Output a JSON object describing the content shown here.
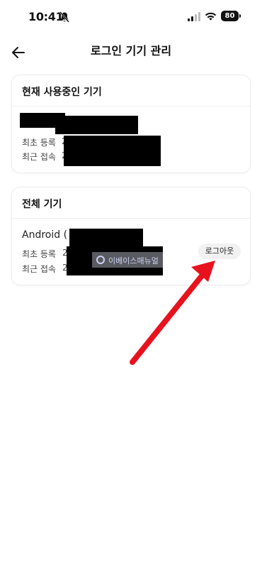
{
  "status_bar": {
    "time": "10:41",
    "battery": "80"
  },
  "header": {
    "title": "로그인 기기 관리",
    "back_icon": "back-arrow-icon"
  },
  "current_device": {
    "title": "현재 사용중인 기기",
    "first_registered_label": "최초 등록",
    "first_registered_partial": "2",
    "last_access_label": "최근 접속",
    "last_access_partial": "2"
  },
  "all_devices": {
    "title": "전체 기기",
    "device_name": "Android (",
    "first_registered_label": "최초 등록",
    "first_registered_partial": "2",
    "last_access_label": "최근 접속",
    "last_access_partial": "2",
    "logout_label": "로그아웃"
  },
  "watermark": {
    "text": "이베이스매뉴얼"
  },
  "colors": {
    "annotation_arrow": "#e8121e",
    "redaction": "#000000",
    "logout_bg": "#f1f1f1"
  }
}
